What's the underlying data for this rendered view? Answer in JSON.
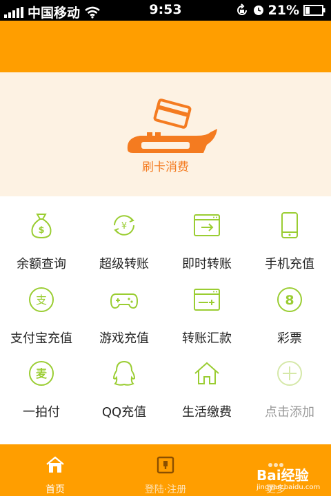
{
  "status_bar": {
    "carrier": "中国移动",
    "time": "9:53",
    "battery": "21%",
    "icons": [
      "signal-bars",
      "wifi-icon",
      "rotation-lock-icon",
      "alarm-icon",
      "battery-icon"
    ]
  },
  "banner": {
    "caption": "刷卡消费",
    "icon": "card-swipe-terminal-icon",
    "accent": "#f47b20",
    "background": "#fdf2e3"
  },
  "grid": {
    "icon_color": "#9acd32",
    "items": [
      {
        "label": "余额查询",
        "icon": "money-bag-icon"
      },
      {
        "label": "超级转账",
        "icon": "yuan-cycle-icon"
      },
      {
        "label": "即时转账",
        "icon": "window-arrow-icon"
      },
      {
        "label": "手机充值",
        "icon": "mobile-phone-icon"
      },
      {
        "label": "支付宝充值",
        "icon": "alipay-icon"
      },
      {
        "label": "游戏充值",
        "icon": "gamepad-icon"
      },
      {
        "label": "转账汇款",
        "icon": "window-transfer-icon"
      },
      {
        "label": "彩票",
        "icon": "lottery-ball-icon"
      },
      {
        "label": "一拍付",
        "icon": "scan-pay-icon"
      },
      {
        "label": "QQ充值",
        "icon": "qq-penguin-icon"
      },
      {
        "label": "生活缴费",
        "icon": "house-icon"
      },
      {
        "label": "点击添加",
        "icon": "add-icon"
      }
    ]
  },
  "tabbar": {
    "background": "#ff9e00",
    "tabs": [
      {
        "label": "首页",
        "icon": "home-icon"
      },
      {
        "label": "登陆·注册",
        "icon": "login-door-icon"
      },
      {
        "label": "更多",
        "icon": "more-icon"
      }
    ]
  },
  "watermark": {
    "logo": "Bai经验",
    "url": "jingyan.baidu.com"
  }
}
